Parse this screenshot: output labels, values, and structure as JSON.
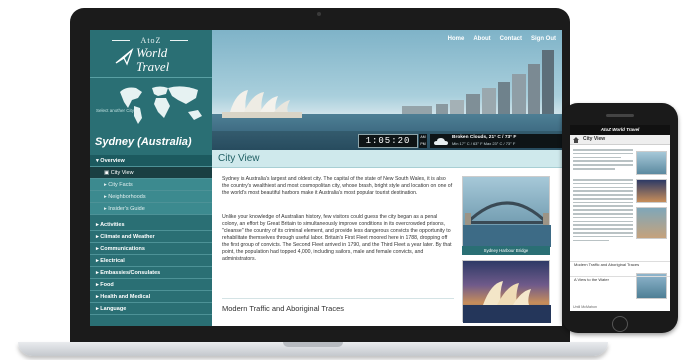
{
  "site": {
    "logo": {
      "small": "AtoZ",
      "line1": "World",
      "line2": "Travel"
    },
    "select_city": "Select another City",
    "city_title": "Sydney (Australia)",
    "header_nav": [
      "Home",
      "About",
      "Contact",
      "Sign Out"
    ],
    "clock": "1:05:20",
    "clock_ampm": "AM PM",
    "weather_main": "Broken Clouds, 21° C / 73° F",
    "weather_sub": "Min 17° C / 63° F  Max 23° C / 73° F"
  },
  "sidebar_nav": [
    {
      "type": "header",
      "label": "▾ Overview"
    },
    {
      "type": "sub",
      "label": "▣ City View",
      "selected": true
    },
    {
      "type": "sub",
      "label": "▸ City Facts"
    },
    {
      "type": "sub",
      "label": "▸ Neighborhoods"
    },
    {
      "type": "sub",
      "label": "▸ Insider's Guide"
    },
    {
      "type": "gap"
    },
    {
      "type": "item",
      "label": "▸ Activities"
    },
    {
      "type": "item",
      "label": "▸ Climate and Weather"
    },
    {
      "type": "item",
      "label": "▸ Communications"
    },
    {
      "type": "item",
      "label": "▸ Electrical"
    },
    {
      "type": "item",
      "label": "▸ Embassies/Consulates"
    },
    {
      "type": "item",
      "label": "▸ Food"
    },
    {
      "type": "item",
      "label": "▸ Health and Medical"
    },
    {
      "type": "item",
      "label": "▸ Language"
    }
  ],
  "content": {
    "title": "City View",
    "p1": "Sydney is Australia's largest and oldest city. The capital of the state of New South Wales, it is also the country's wealthiest and most cosmopolitan city, whose brash, bright style and location on one of the world's most beautiful harbors make it Australia's most popular tourist destination.",
    "p2": "Unlike your knowledge of Australian history, few visitors could guess the city began as a penal colony, an effort by Great Britain to simultaneously improve conditions in its overcrowded prisons, \"cleanse\" the country of its criminal element, and provide less dangerous convicts the opportunity to rehabilitate themselves through useful labor. Britain's First Fleet moored here in 1788, dropping off the first group of convicts. The Second Fleet arrived in 1790, and the Third Fleet a year later. By that point, the population had topped 4,000, including sailors, male and female convicts, and administrators.",
    "photo_caption": "Sydney Harbour Bridge",
    "subheading": "Modern Traffic and Aboriginal Traces"
  },
  "phone": {
    "app_title": "AtoZ World Travel",
    "page_title": "City View",
    "links": [
      "Modern Traffic and Aboriginal Traces",
      "A View to the Water"
    ],
    "note": "Until McMahon"
  }
}
